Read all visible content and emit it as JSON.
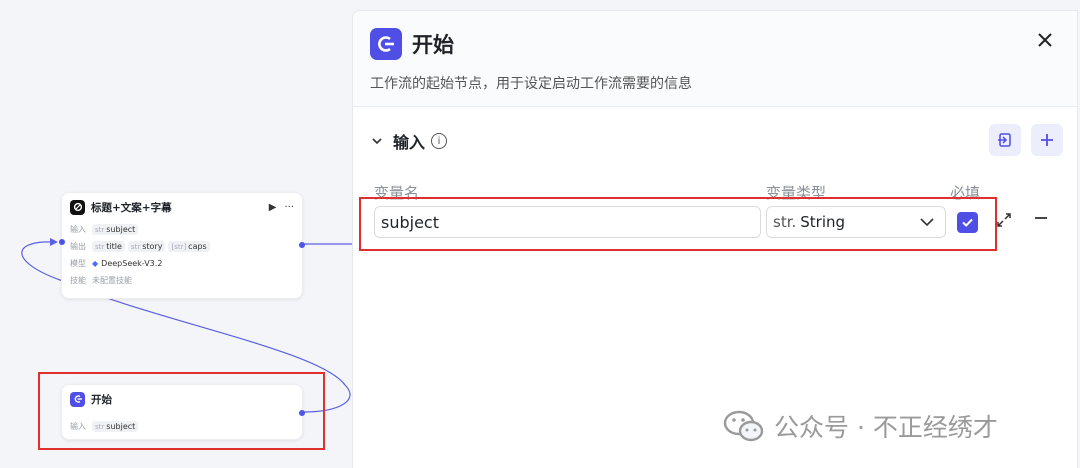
{
  "nodes": {
    "llm": {
      "title": "标题+文案+字幕",
      "actions": {
        "run": "▶",
        "more": "···"
      },
      "input_key": "输入",
      "input_vars": [
        {
          "type": "str",
          "name": "subject"
        }
      ],
      "output_key": "输出",
      "output_vars": [
        {
          "type": "str",
          "name": "title"
        },
        {
          "type": "str",
          "name": "story"
        },
        {
          "type": "[str]",
          "name": "caps"
        }
      ],
      "model_key": "模型",
      "model_value": "DeepSeek-V3.2",
      "skill_key": "技能",
      "skill_value": "未配置技能"
    },
    "start": {
      "title": "开始",
      "input_key": "输入",
      "input_vars": [
        {
          "type": "str",
          "name": "subject"
        }
      ]
    }
  },
  "panel": {
    "title": "开始",
    "description": "工作流的起始节点，用于设定启动工作流需要的信息",
    "section_label": "输入",
    "columns": {
      "name": "变量名",
      "type": "变量类型",
      "required": "必填"
    },
    "variable": {
      "name": "subject",
      "type_prefix": "str.",
      "type": "String",
      "required": true
    }
  },
  "watermark": {
    "text": "公众号 · 不正经绣才"
  },
  "colors": {
    "accent": "#4f4fe6",
    "highlight": "#e0302e"
  }
}
